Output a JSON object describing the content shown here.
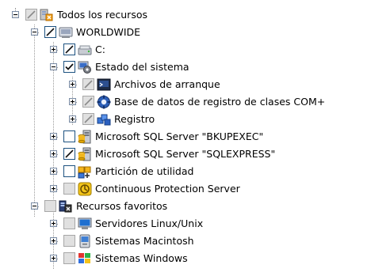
{
  "tree": {
    "nodes": [
      {
        "id": "todos",
        "label": "Todos los recursos",
        "level": 0,
        "expander": "minus",
        "check": "grey-check",
        "icon": "all-resources-icon"
      },
      {
        "id": "worldwide",
        "label": "WORLDWIDE",
        "level": 1,
        "expander": "minus",
        "check": "diagonal",
        "icon": "server-icon"
      },
      {
        "id": "drive-c",
        "label": "C:",
        "level": 2,
        "expander": "plus",
        "check": "diagonal",
        "icon": "drive-icon"
      },
      {
        "id": "estado",
        "label": "Estado del sistema",
        "level": 2,
        "expander": "minus",
        "check": "check",
        "icon": "system-state-icon"
      },
      {
        "id": "archivos",
        "label": "Archivos de arranque",
        "level": 3,
        "expander": "plus",
        "check": "grey-diagonal",
        "icon": "boot-files-icon"
      },
      {
        "id": "com",
        "label": "Base de datos de registro de clases COM+",
        "level": 3,
        "expander": "plus",
        "check": "grey-diagonal",
        "icon": "com-plus-icon"
      },
      {
        "id": "registro",
        "label": "Registro",
        "level": 3,
        "expander": "plus",
        "check": "grey-diagonal",
        "icon": "registry-icon"
      },
      {
        "id": "sql-bkup",
        "label": "Microsoft SQL Server \"BKUPEXEC\"",
        "level": 2,
        "expander": "plus",
        "check": "empty",
        "icon": "sql-server-icon"
      },
      {
        "id": "sql-express",
        "label": "Microsoft SQL Server \"SQLEXPRESS\"",
        "level": 2,
        "expander": "plus",
        "check": "diagonal",
        "icon": "sql-server-icon"
      },
      {
        "id": "particion",
        "label": "Partición de utilidad",
        "level": 2,
        "expander": "plus",
        "check": "empty",
        "icon": "utility-partition-icon"
      },
      {
        "id": "cps",
        "label": "Continuous Protection Server",
        "level": 2,
        "expander": "plus",
        "check": "grey",
        "icon": "cps-icon"
      },
      {
        "id": "favoritos",
        "label": "Recursos favoritos",
        "level": 1,
        "expander": "minus",
        "check": "grey",
        "icon": "favorite-resources-icon"
      },
      {
        "id": "linux",
        "label": "Servidores Linux/Unix",
        "level": 2,
        "expander": "plus",
        "check": "grey",
        "icon": "linux-servers-icon"
      },
      {
        "id": "mac",
        "label": "Sistemas Macintosh",
        "level": 2,
        "expander": "plus",
        "check": "grey",
        "icon": "mac-systems-icon"
      },
      {
        "id": "windows",
        "label": "Sistemas Windows",
        "level": 2,
        "expander": "plus",
        "check": "grey",
        "icon": "windows-systems-icon"
      }
    ]
  }
}
